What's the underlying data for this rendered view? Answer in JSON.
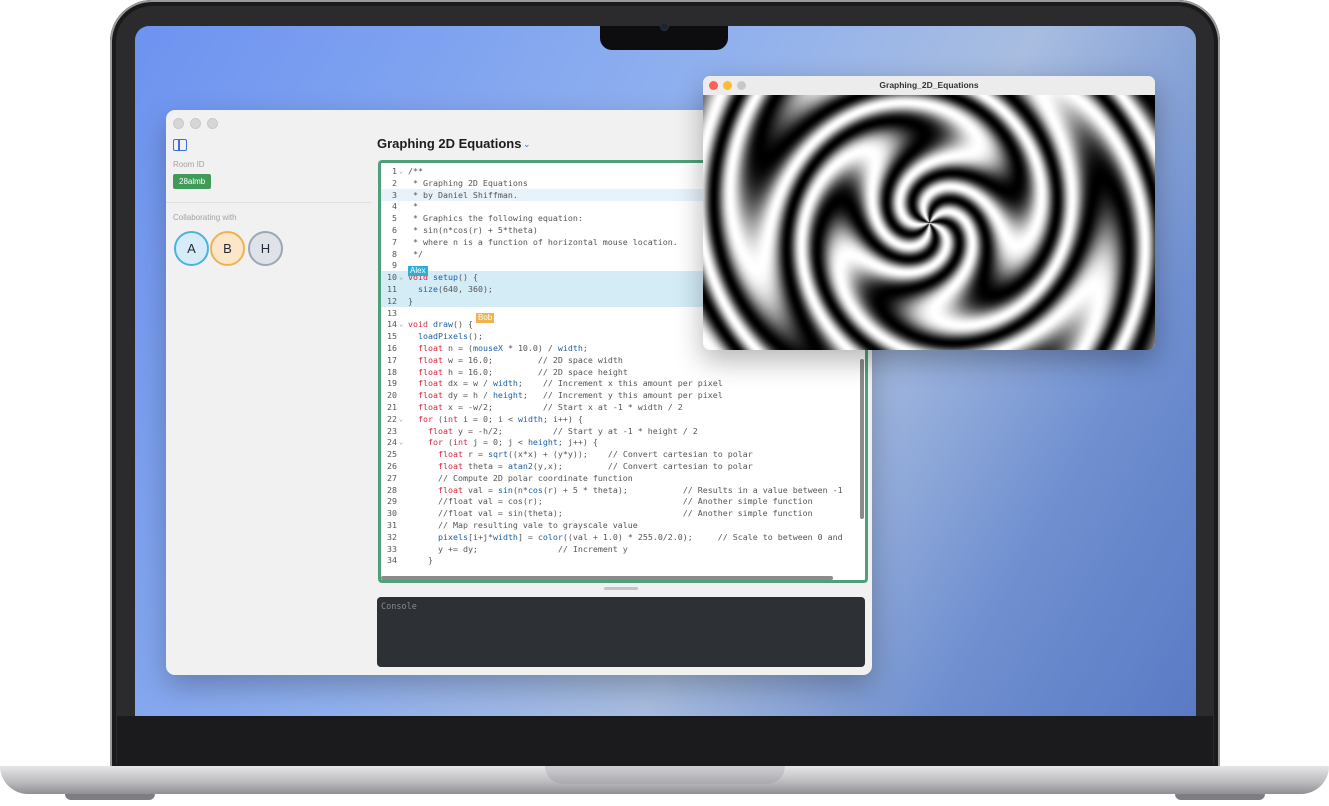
{
  "editor": {
    "room_id_label": "Room ID",
    "room_id": "28almb",
    "collab_label": "Collaborating with",
    "collaborators": [
      "A",
      "B",
      "H"
    ],
    "doc_title": "Graphing 2D Equations",
    "cursors": {
      "alex": "Alex",
      "bob": "Bob"
    },
    "console_placeholder": "Console",
    "code": [
      "/**",
      " * Graphing 2D Equations",
      " * by Daniel Shiffman.",
      " *",
      " * Graphics the following equation:",
      " * sin(n*cos(r) + 5*theta)",
      " * where n is a function of horizontal mouse location.",
      " */",
      "",
      "void setup() {",
      "  size(640, 360);",
      "}",
      "",
      "void draw() {",
      "  loadPixels();",
      "  float n = (mouseX * 10.0) / width;",
      "  float w = 16.0;         // 2D space width",
      "  float h = 16.0;         // 2D space height",
      "  float dx = w / width;    // Increment x this amount per pixel",
      "  float dy = h / height;   // Increment y this amount per pixel",
      "  float x = -w/2;          // Start x at -1 * width / 2",
      "  for (int i = 0; i < width; i++) {",
      "    float y = -h/2;          // Start y at -1 * height / 2",
      "    for (int j = 0; j < height; j++) {",
      "      float r = sqrt((x*x) + (y*y));    // Convert cartesian to polar",
      "      float theta = atan2(y,x);         // Convert cartesian to polar",
      "      // Compute 2D polar coordinate function",
      "      float val = sin(n*cos(r) + 5 * theta);           // Results in a value between -1",
      "      //float val = cos(r);                            // Another simple function",
      "      //float val = sin(theta);                        // Another simple function",
      "      // Map resulting vale to grayscale value",
      "      pixels[i+j*width] = color((val + 1.0) * 255.0/2.0);     // Scale to between 0 and",
      "      y += dy;                // Increment y",
      "    }"
    ]
  },
  "output": {
    "title": "Graphing_2D_Equations"
  },
  "colors": {
    "accent_green": "#4fa07a",
    "badge_green": "#3f9b57",
    "alex_cursor": "#2eaed6",
    "bob_cursor": "#f0b24f"
  }
}
